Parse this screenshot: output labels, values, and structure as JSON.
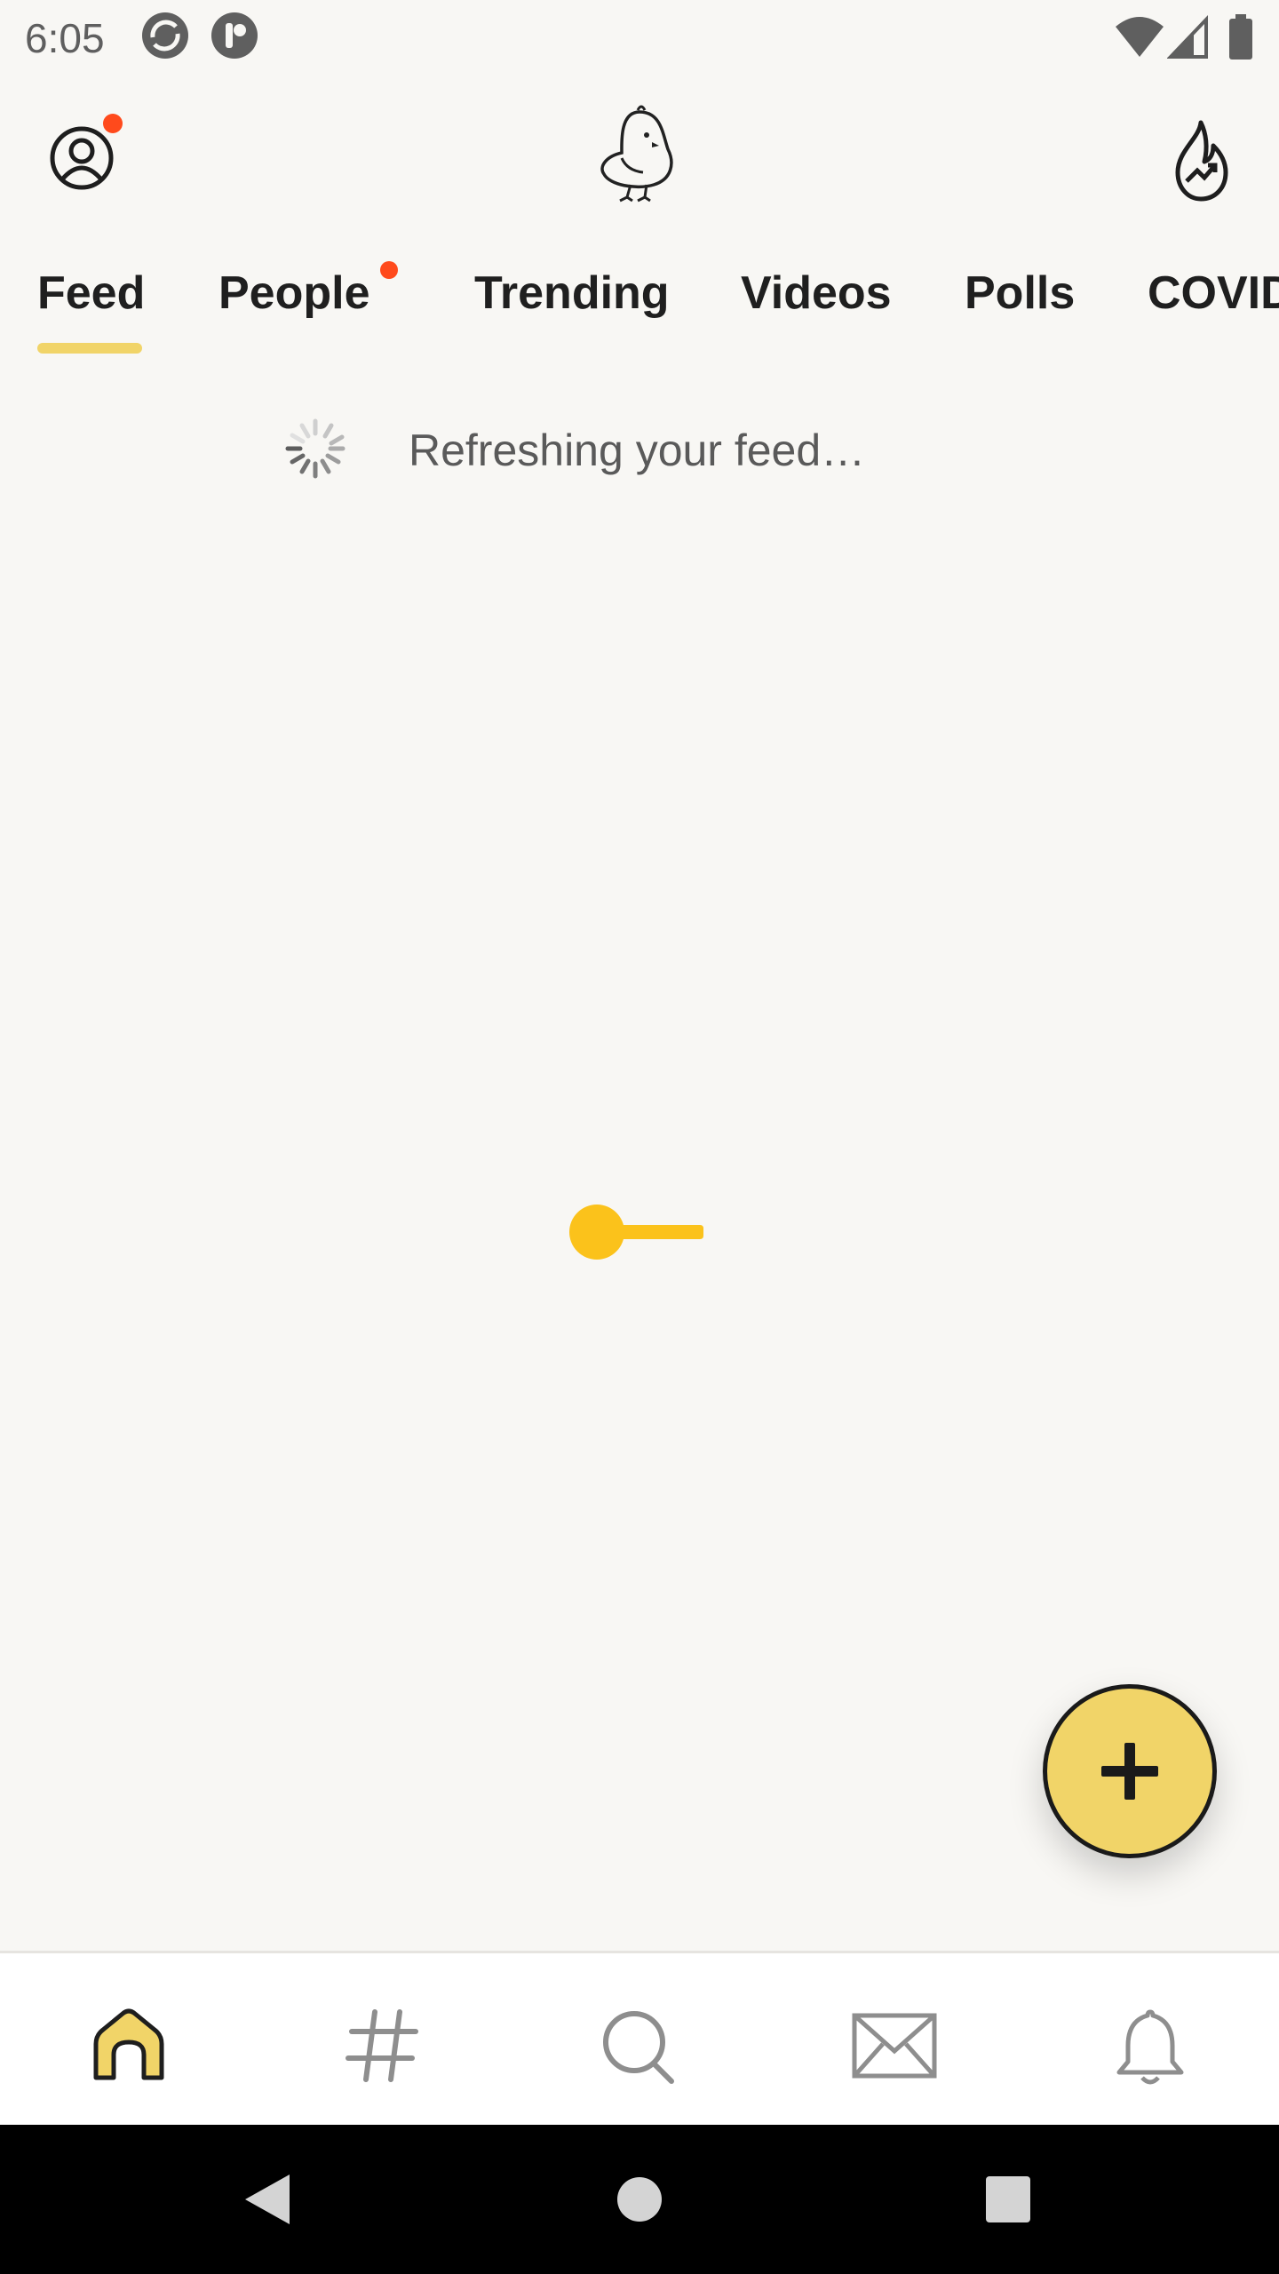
{
  "status_bar": {
    "time": "6:05",
    "icons_left": [
      "sync-app-icon",
      "pill-app-icon"
    ],
    "icons_right": [
      "wifi-icon",
      "signal-icon",
      "battery-icon"
    ]
  },
  "top_bar": {
    "profile_icon": "profile-icon",
    "has_profile_notification": true,
    "logo_icon": "koo-bird-logo",
    "trending_icon": "trending-flame-icon"
  },
  "tabs": [
    {
      "label": "Feed",
      "active": true
    },
    {
      "label": "People",
      "has_dot": true
    },
    {
      "label": "Trending"
    },
    {
      "label": "Videos"
    },
    {
      "label": "Polls"
    },
    {
      "label": "COVID"
    }
  ],
  "refresh": {
    "text": "Refreshing your feed…"
  },
  "fab": {
    "icon": "plus-icon"
  },
  "bottom_nav": [
    {
      "icon": "home-icon",
      "active": true
    },
    {
      "icon": "hashtag-icon"
    },
    {
      "icon": "search-icon"
    },
    {
      "icon": "mail-icon"
    },
    {
      "icon": "bell-icon"
    }
  ],
  "colors": {
    "background": "#f8f7f4",
    "accent": "#f1d468",
    "loader": "#fbc21b",
    "notification_dot": "#ff4a1c"
  }
}
